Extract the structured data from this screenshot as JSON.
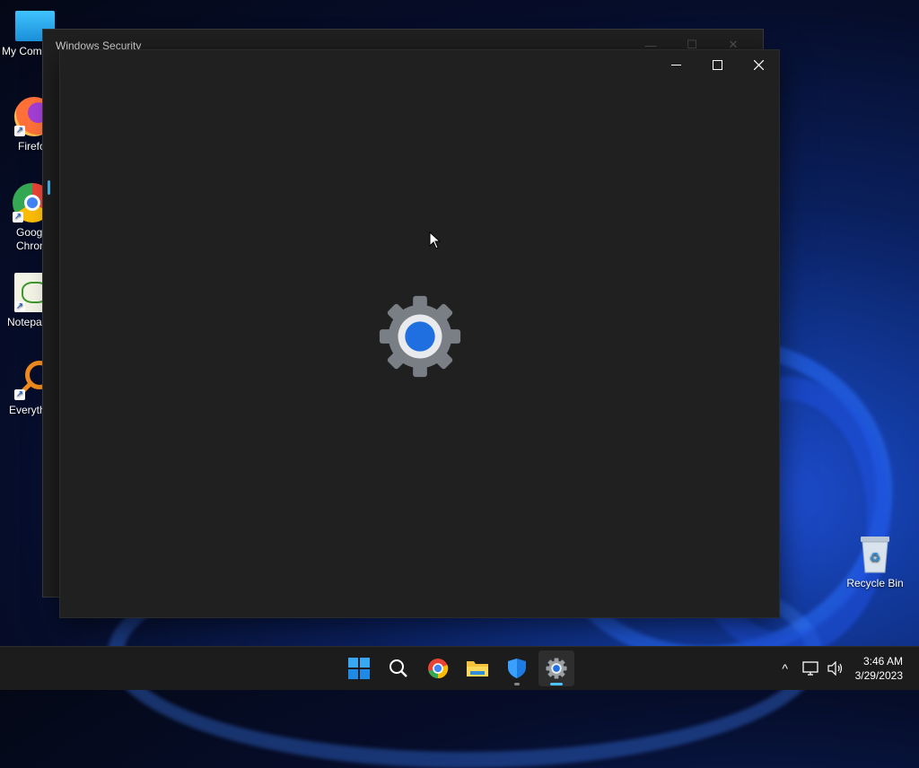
{
  "desktop": {
    "icons": [
      {
        "label": "My Com",
        "icon": "monitor-icon"
      },
      {
        "label": "Firefo",
        "icon": "firefox-icon"
      },
      {
        "label": "Goog\nChron",
        "icon": "chrome-icon"
      },
      {
        "label": "Notepa",
        "icon": "notepad-icon"
      },
      {
        "label": "Everyth",
        "icon": "search-magnifier-icon"
      }
    ],
    "recycle_bin": {
      "label": "Recycle Bin",
      "icon": "recycle-bin-icon"
    }
  },
  "security_window": {
    "title": "Windows Security",
    "controls": {
      "minimize": "—",
      "maximize": "☐",
      "close": "✕"
    }
  },
  "settings_window": {
    "state": "loading",
    "splash_icon": "settings-gear-icon",
    "controls": {
      "minimize": "minimize-icon",
      "maximize": "maximize-icon",
      "close": "close-icon"
    }
  },
  "taskbar": {
    "apps": [
      {
        "name": "start",
        "icon": "windows-start-icon"
      },
      {
        "name": "search",
        "icon": "search-icon"
      },
      {
        "name": "chrome",
        "icon": "chrome-icon"
      },
      {
        "name": "file-explorer",
        "icon": "folder-icon"
      },
      {
        "name": "windows-security",
        "icon": "shield-icon",
        "running": true
      },
      {
        "name": "settings",
        "icon": "gear-icon",
        "active": true
      }
    ],
    "tray": {
      "chevron": "^",
      "network": "network-icon",
      "volume": "volume-icon"
    },
    "clock": {
      "time": "3:46 AM",
      "date": "3/29/2023"
    }
  },
  "colors": {
    "accent": "#4cc2ff",
    "window_bg": "#202020",
    "taskbar_bg": "#1c1c1c",
    "gear_grey": "#7a7f86",
    "gear_blue": "#1f6fe0"
  }
}
